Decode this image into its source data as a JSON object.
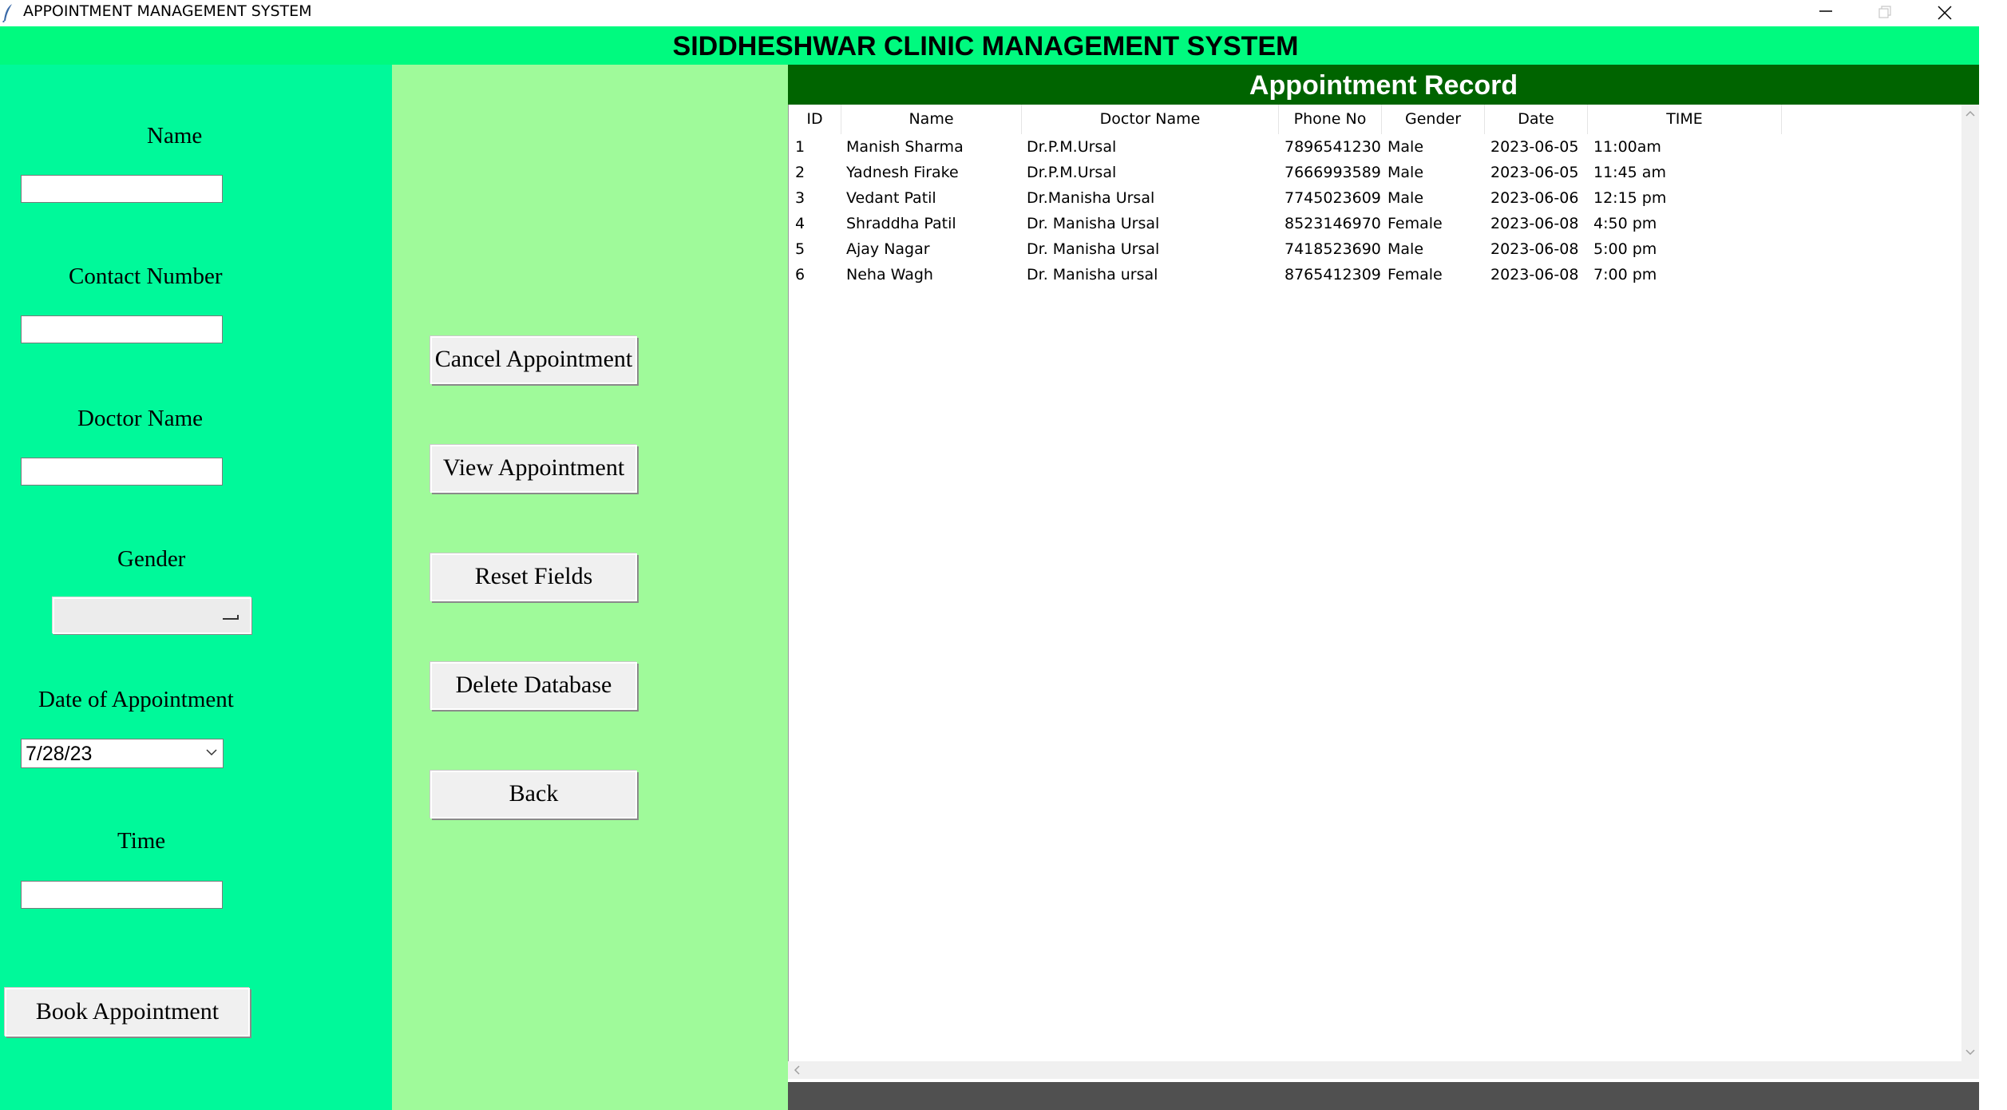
{
  "window": {
    "title": "APPOINTMENT MANAGEMENT SYSTEM"
  },
  "header": {
    "title": "SIDDHESHWAR CLINIC MANAGEMENT SYSTEM"
  },
  "form": {
    "name_label": "Name",
    "name_value": "",
    "contact_label": "Contact Number",
    "contact_value": "",
    "doctor_label": "Doctor Name",
    "doctor_value": "",
    "gender_label": "Gender",
    "gender_value": "",
    "date_label": "Date of Appointment",
    "date_value": "7/28/23",
    "time_label": "Time",
    "time_value": "",
    "book_button": "Book Appointment"
  },
  "actions": {
    "cancel": "Cancel Appointment",
    "view": "View Appointment",
    "reset": "Reset Fields",
    "delete": "Delete Database",
    "back": "Back"
  },
  "records": {
    "title": "Appointment Record",
    "columns": [
      "ID",
      "Name",
      "Doctor Name",
      "Phone No",
      "Gender",
      "Date",
      "TIME"
    ],
    "rows": [
      [
        "1",
        "Manish Sharma",
        "Dr.P.M.Ursal",
        "7896541230",
        "Male",
        "2023-06-05",
        "11:00am"
      ],
      [
        "2",
        "Yadnesh Firake",
        "Dr.P.M.Ursal",
        "7666993589",
        "Male",
        "2023-06-05",
        "11:45 am"
      ],
      [
        "3",
        "Vedant Patil",
        "Dr.Manisha  Ursal",
        "7745023609",
        "Male",
        "2023-06-06",
        "12:15 pm"
      ],
      [
        "4",
        "Shraddha Patil",
        "Dr. Manisha Ursal",
        "8523146970",
        "Female",
        "2023-06-08",
        "4:50 pm"
      ],
      [
        "5",
        "Ajay Nagar",
        "Dr. Manisha Ursal",
        "7418523690",
        "Male",
        "2023-06-08",
        "5:00 pm"
      ],
      [
        "6",
        "Neha Wagh",
        "Dr. Manisha ursal",
        "8765412309",
        "Female",
        "2023-06-08",
        "7:00 pm"
      ]
    ]
  },
  "colors": {
    "header_bg": "#00fa7f",
    "left_panel_bg": "#00f99a",
    "mid_panel_bg": "#9ffa9a",
    "record_header_bg": "#006400"
  }
}
